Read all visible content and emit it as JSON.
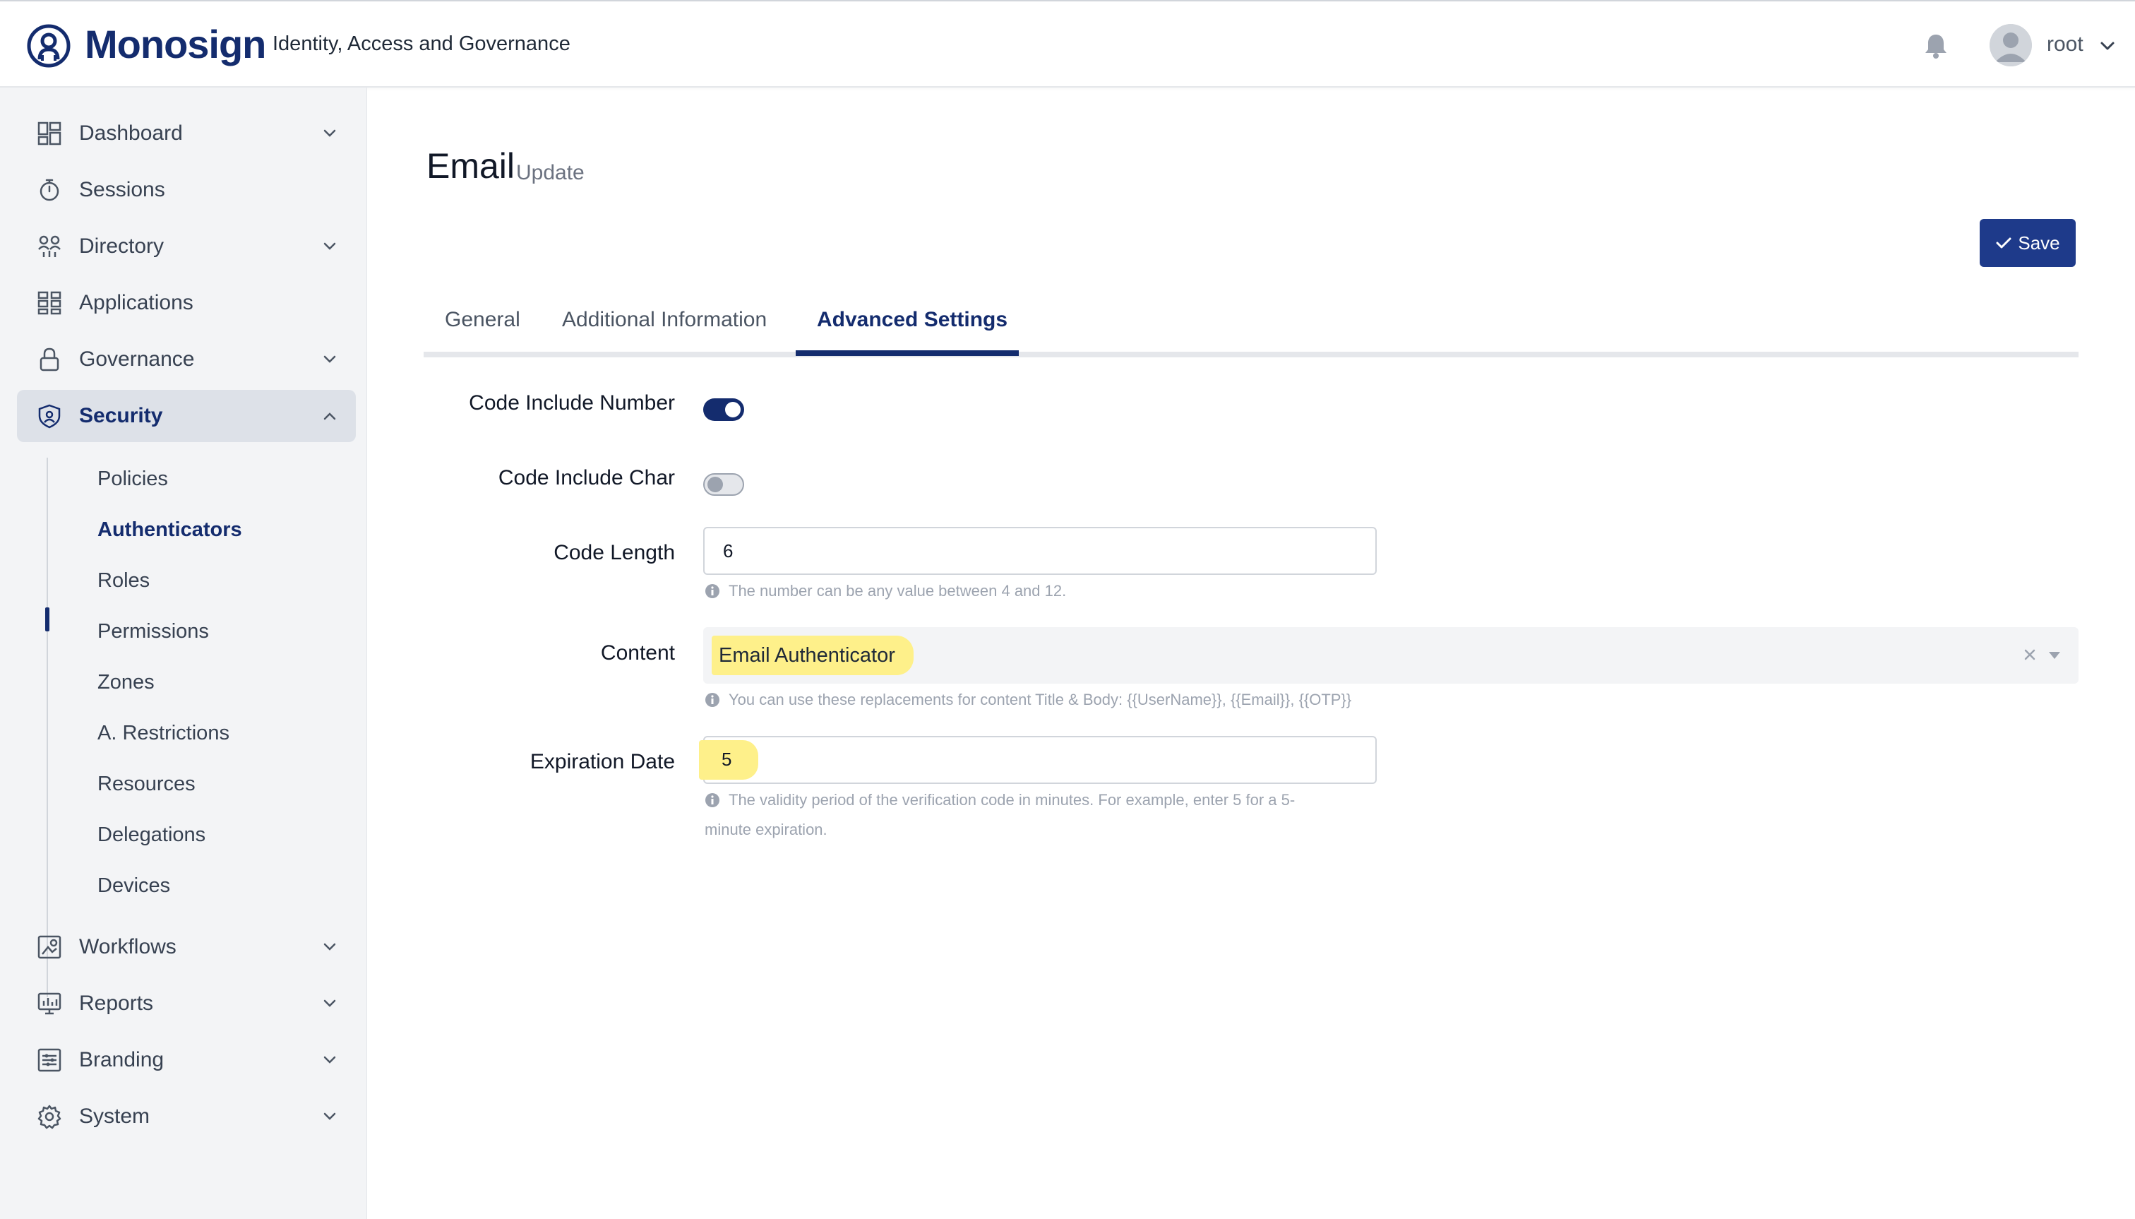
{
  "header": {
    "brand": "Monosign",
    "tagline": "Identity, Access and Governance",
    "username": "root",
    "icons": {
      "logo": "monosign-logo",
      "bell": "bell-icon",
      "avatar": "avatar-icon",
      "chevron": "chevron-down-icon"
    }
  },
  "sidebar": {
    "items": [
      {
        "label": "Dashboard",
        "icon": "dashboard-icon",
        "expandable": true
      },
      {
        "label": "Sessions",
        "icon": "stopwatch-icon",
        "expandable": false
      },
      {
        "label": "Directory",
        "icon": "users-icon",
        "expandable": true
      },
      {
        "label": "Applications",
        "icon": "grid-icon",
        "expandable": false
      },
      {
        "label": "Governance",
        "icon": "lock-icon",
        "expandable": true
      },
      {
        "label": "Security",
        "icon": "shield-icon",
        "expandable": true,
        "active": true
      },
      {
        "label": "Workflows",
        "icon": "workflow-icon",
        "expandable": true
      },
      {
        "label": "Reports",
        "icon": "reports-icon",
        "expandable": true
      },
      {
        "label": "Branding",
        "icon": "branding-icon",
        "expandable": true
      },
      {
        "label": "System",
        "icon": "gear-icon",
        "expandable": true
      }
    ],
    "security_children": [
      {
        "label": "Policies"
      },
      {
        "label": "Authenticators",
        "active": true
      },
      {
        "label": "Roles"
      },
      {
        "label": "Permissions"
      },
      {
        "label": "Zones"
      },
      {
        "label": "A. Restrictions"
      },
      {
        "label": "Resources"
      },
      {
        "label": "Delegations"
      },
      {
        "label": "Devices"
      }
    ]
  },
  "page": {
    "title": "Email",
    "subtitle": "Update",
    "save_label": "Save"
  },
  "tabs": [
    {
      "label": "General"
    },
    {
      "label": "Additional Information"
    },
    {
      "label": "Advanced Settings",
      "active": true
    }
  ],
  "form": {
    "code_include_number": {
      "label": "Code Include Number",
      "checked": true
    },
    "code_include_char": {
      "label": "Code Include Char",
      "checked": false
    },
    "code_length": {
      "label": "Code Length",
      "value": "6",
      "hint": "The number can be any value between 4 and 12."
    },
    "content": {
      "label": "Content",
      "value": "Email Authenticator",
      "hint": "You can use these replacements for content Title & Body: {{UserName}}, {{Email}}, {{OTP}}"
    },
    "expiration_date": {
      "label": "Expiration Date",
      "value": "5",
      "hint_line1": "The validity period of the verification code in minutes. For example, enter 5 for a 5-",
      "hint_line2": "minute expiration."
    }
  },
  "colors": {
    "brand": "#142c6e",
    "button": "#1e3a8a",
    "highlight": "#fef08a",
    "sidebar_bg": "#f3f4f6"
  }
}
